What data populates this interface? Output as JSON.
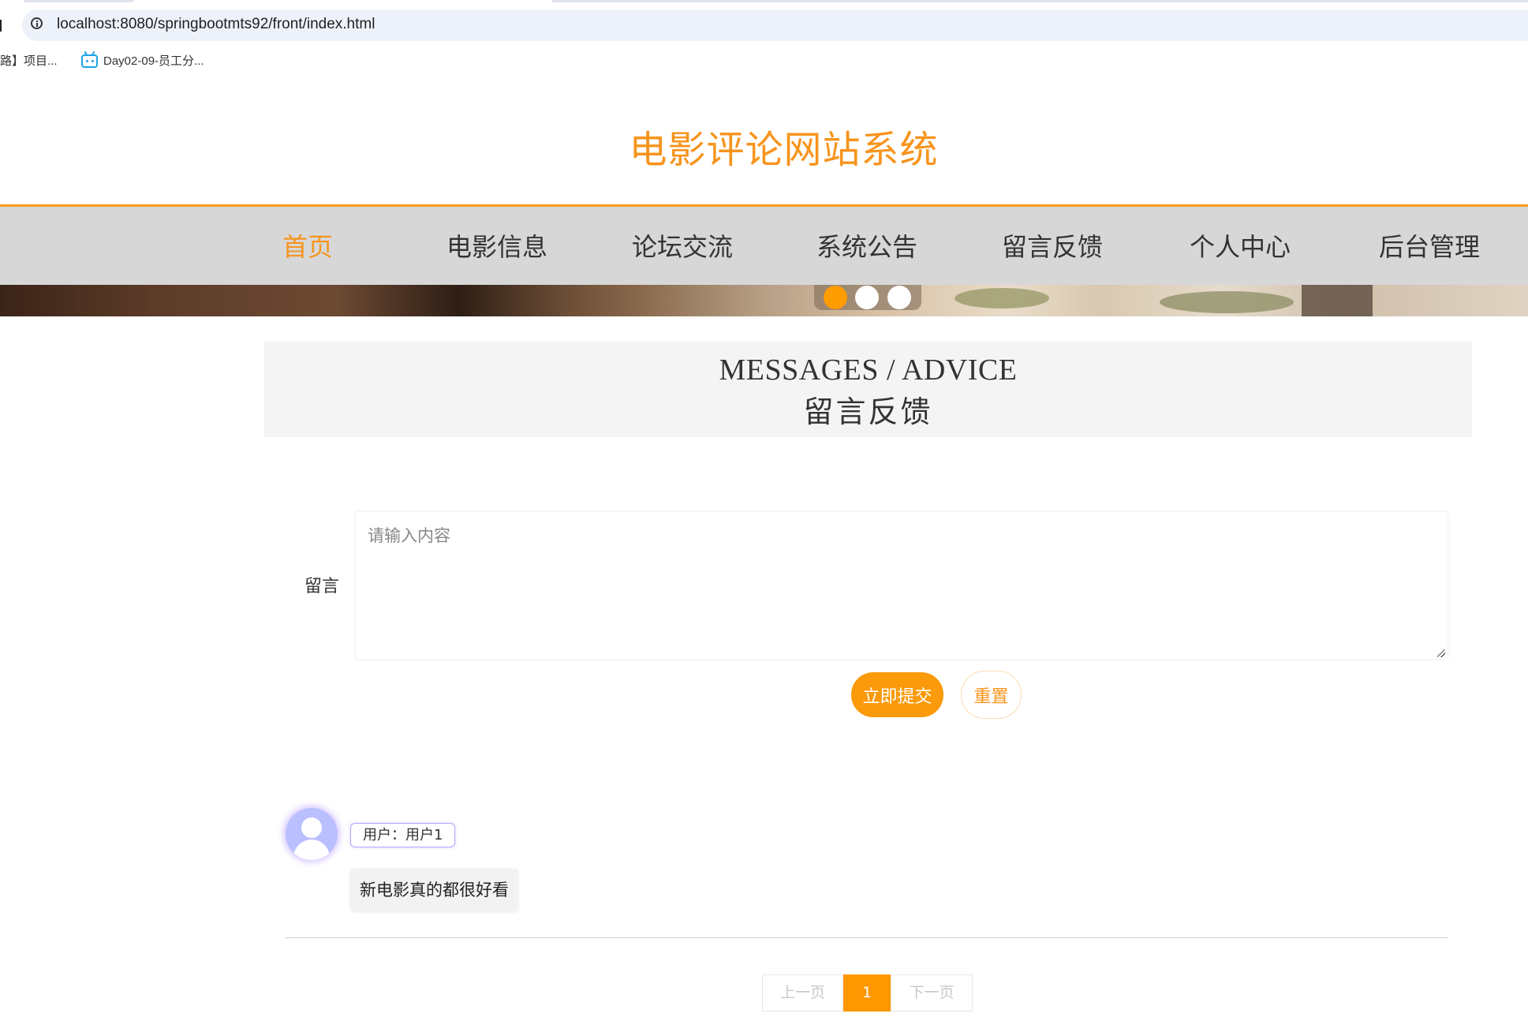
{
  "browser": {
    "url": "localhost:8080/springbootmts92/front/index.html",
    "bookmarks": [
      {
        "label": "路】项目..."
      },
      {
        "label": "Day02-09-员工分..."
      }
    ]
  },
  "site": {
    "title": "电影评论网站系统"
  },
  "nav": {
    "items": [
      {
        "label": "首页",
        "active": true
      },
      {
        "label": "电影信息"
      },
      {
        "label": "论坛交流"
      },
      {
        "label": "系统公告"
      },
      {
        "label": "留言反馈"
      },
      {
        "label": "个人中心"
      },
      {
        "label": "后台管理"
      }
    ]
  },
  "carousel": {
    "active_index": 0,
    "count": 3
  },
  "section": {
    "title_en": "MESSAGES / ADVICE",
    "title_cn": "留言反馈"
  },
  "form": {
    "label": "留言",
    "placeholder": "请输入内容",
    "value": "",
    "submit_label": "立即提交",
    "reset_label": "重置"
  },
  "messages": [
    {
      "user": "用户：用户1",
      "content": "新电影真的都很好看"
    }
  ],
  "pagination": {
    "prev_label": "上一页",
    "current": "1",
    "next_label": "下一页"
  },
  "colors": {
    "accent": "#f7941d",
    "nav_bg": "#d7d7d7",
    "primary_button": "#fb9a0a"
  }
}
